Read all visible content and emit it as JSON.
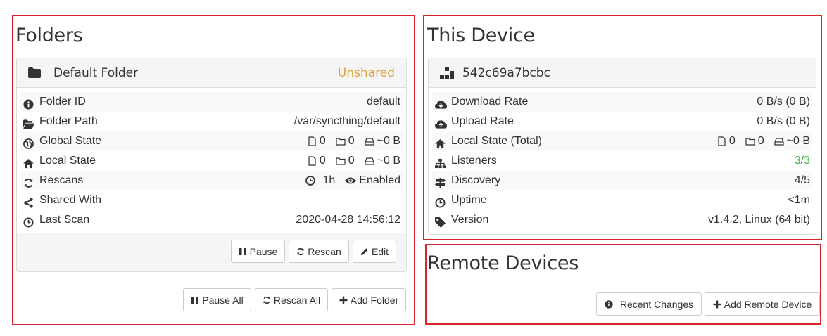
{
  "folders": {
    "title": "Folders",
    "folder": {
      "name": "Default Folder",
      "status": "Unshared",
      "rows": [
        {
          "label": "Folder ID",
          "value": "default"
        },
        {
          "label": "Folder Path",
          "value": "/var/syncthing/default"
        },
        {
          "label": "Global State",
          "files": "0",
          "dirs": "0",
          "size": "~0 B"
        },
        {
          "label": "Local State",
          "files": "0",
          "dirs": "0",
          "size": "~0 B"
        },
        {
          "label": "Rescans",
          "interval": "1h",
          "watch": "Enabled"
        },
        {
          "label": "Shared With",
          "value": ""
        },
        {
          "label": "Last Scan",
          "value": "2020-04-28 14:56:12"
        }
      ],
      "buttons": {
        "pause": "Pause",
        "rescan": "Rescan",
        "edit": "Edit"
      }
    },
    "buttons": {
      "pause_all": "Pause All",
      "rescan_all": "Rescan All",
      "add_folder": "Add Folder"
    }
  },
  "device": {
    "title": "This Device",
    "name": "542c69a7bcbc",
    "rows": [
      {
        "label": "Download Rate",
        "value": "0 B/s (0 B)"
      },
      {
        "label": "Upload Rate",
        "value": "0 B/s (0 B)"
      },
      {
        "label": "Local State (Total)",
        "files": "0",
        "dirs": "0",
        "size": "~0 B"
      },
      {
        "label": "Listeners",
        "value": "3/3"
      },
      {
        "label": "Discovery",
        "value": "4/5"
      },
      {
        "label": "Uptime",
        "value": "<1m"
      },
      {
        "label": "Version",
        "value": "v1.4.2, Linux (64 bit)"
      }
    ]
  },
  "remote": {
    "title": "Remote Devices",
    "buttons": {
      "recent_changes": "Recent Changes",
      "add_remote": "Add Remote Device"
    }
  },
  "colors": {
    "unshared": "#e2a33c",
    "ok": "#3fb13f",
    "highlight_border": "#d9232d"
  }
}
